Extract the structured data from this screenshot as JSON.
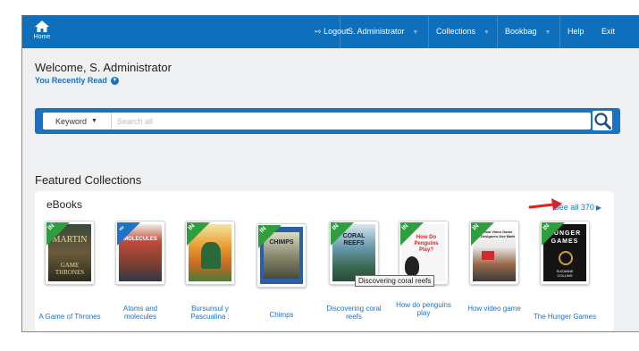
{
  "nav": {
    "home_label": "Home",
    "logout": "Logout",
    "user": "S. Administrator",
    "collections": "Collections",
    "bookbag": "Bookbag",
    "help": "Help",
    "exit": "Exit"
  },
  "welcome": "Welcome, S. Administrator",
  "recently_read": "You Recently Read",
  "search": {
    "type": "Keyword",
    "placeholder": "Search all"
  },
  "featured_heading": "Featured Collections",
  "ebooks": {
    "title": "eBooks",
    "see_all": "See all 370",
    "books": [
      {
        "title": "A Game of Thrones",
        "badge": "IN",
        "cover_text": "MARTIN"
      },
      {
        "title": "Atoms and molecules",
        "badge": "∞",
        "cover_text": "MOLECULES"
      },
      {
        "title": "Bursunsul y Pascualina :",
        "badge": "IN"
      },
      {
        "title": "Chimps",
        "badge": "IN",
        "cover_text": "CHIMPS"
      },
      {
        "title": "Discovering coral reefs",
        "badge": "IN",
        "cover_text": "CORAL REEFS"
      },
      {
        "title": "How do penguins play",
        "badge": "IN",
        "cover_text": "How Do Penguins Play?"
      },
      {
        "title": "How video game",
        "badge": "IN",
        "cover_text": "How Video Game Designers Use Math"
      },
      {
        "title": "The Hunger Games",
        "badge": "IN",
        "cover_text": "HUNGER GAMES"
      }
    ]
  },
  "tooltip": "Discovering coral reefs",
  "colors": {
    "brand": "#0e6fbd",
    "badge_green": "#2f9e3f",
    "badge_blue": "#1f72c4",
    "annotation": "#e02020"
  }
}
